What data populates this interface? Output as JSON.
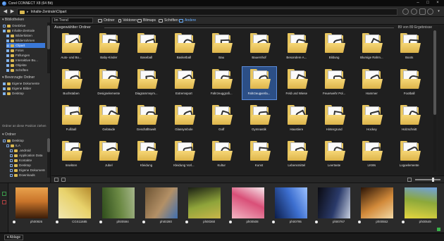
{
  "window": {
    "title": "Corel CONNECT X8 (64 Bit)"
  },
  "address_bar": {
    "path": "Inhalte-Zentrale\\Clipart"
  },
  "left_panel": {
    "library_header": "Bibliotheken",
    "library_items": [
      {
        "label": "OneDrive",
        "checked": false,
        "selected": false,
        "depth": 0
      },
      {
        "label": "Inhalte-Zentrale",
        "checked": true,
        "selected": false,
        "depth": 0
      },
      {
        "label": "Bilderkisten",
        "checked": true,
        "selected": false,
        "depth": 1
      },
      {
        "label": "Bilderrahmen",
        "checked": true,
        "selected": false,
        "depth": 1
      },
      {
        "label": "Clipart",
        "checked": true,
        "selected": true,
        "depth": 1
      },
      {
        "label": "Fotos",
        "checked": true,
        "selected": false,
        "depth": 1
      },
      {
        "label": "Füllungen",
        "checked": true,
        "selected": false,
        "depth": 1
      },
      {
        "label": "Interaktive Bu...",
        "checked": true,
        "selected": false,
        "depth": 1
      },
      {
        "label": "Objekte",
        "checked": true,
        "selected": false,
        "depth": 1
      },
      {
        "label": "Schriften",
        "checked": true,
        "selected": false,
        "depth": 1
      }
    ],
    "favorites_header": "Bevorzugte Ordner",
    "favorite_items": [
      {
        "label": "Eigene Dokumente",
        "checked": true
      },
      {
        "label": "Eigene Bilder",
        "checked": true
      },
      {
        "label": "Desktop",
        "checked": true
      }
    ],
    "drag_hint": "Ordner an diese Position ziehen",
    "folders_header": "Ordner",
    "folder_items": [
      {
        "label": "Desktop",
        "depth": 0
      },
      {
        "label": "ILA",
        "depth": 1
      },
      {
        "label": ".android",
        "depth": 2
      },
      {
        "label": "Application Data",
        "depth": 2
      },
      {
        "label": "Kontakte",
        "depth": 2
      },
      {
        "label": "Desktop",
        "depth": 2
      },
      {
        "label": "Eigene Dokumente",
        "depth": 2
      },
      {
        "label": "Downloads",
        "depth": 2
      }
    ]
  },
  "toolbar": {
    "search_value": "Im Trend",
    "buttons": [
      {
        "label": "Ordner",
        "icon": "folder-icon",
        "active": false
      },
      {
        "label": "Vektoren",
        "icon": "vector-icon",
        "active": false
      },
      {
        "label": "Bitmaps",
        "icon": "bitmap-icon",
        "active": false
      },
      {
        "label": "Schriften",
        "icon": "font-icon",
        "active": false
      },
      {
        "label": "Andere",
        "icon": "other-icon",
        "active": true
      }
    ]
  },
  "content": {
    "header": "Ausgewählter Ordner",
    "count": "89 von 89 Ergebnisse",
    "folders": [
      "Auto- und Bo...",
      "Baby-Kinder",
      "Baseball",
      "Basketball",
      "Bau",
      "Bauernhof",
      "Besondere A...",
      "Bildung",
      "Blumige Rahm...",
      "Boots",
      "Buchstaben",
      "Designelemente",
      "Diagrammsym...",
      "Extremsport",
      "Fahrzeuggrafi...",
      "Fahrzeugverla...",
      "Feld und Wiese",
      "Feuerwehr Pol...",
      "Hammer",
      "Football",
      "Fußball",
      "Gebäude",
      "Geschäftswelt",
      "Glassymbole",
      "Golf",
      "Gymnastik",
      "Haustiere",
      "Hintergrund",
      "Hockey",
      "Holzschnitt",
      "Insekten",
      "Jubel",
      "Kleidung",
      "Kleidung Vorl...",
      "Kultur",
      "Kunst",
      "Lebensmittel",
      "Leertaste",
      "LKWs",
      "Logoelemente"
    ],
    "selected_index": 15
  },
  "tray": {
    "items": [
      {
        "caption": "ph00926",
        "palette": [
          "#3a1d0a",
          "#c9742a",
          "#e8a24d"
        ]
      },
      {
        "caption": "CGS11685",
        "palette": [
          "#f1e7b0",
          "#e8d26b",
          "#b58b2e"
        ]
      },
      {
        "caption": "ph00594",
        "palette": [
          "#2f4d1c",
          "#6c8a45",
          "#a5b58a"
        ]
      },
      {
        "caption": "ph00280",
        "palette": [
          "#6d5434",
          "#b39066",
          "#3f6fb0"
        ]
      },
      {
        "caption": "ph00360",
        "palette": [
          "#1a1f14",
          "#8fa43a",
          "#c9b64a"
        ]
      },
      {
        "caption": "ph00508",
        "palette": [
          "#f2b6c4",
          "#d94f78",
          "#f7e8ec"
        ]
      },
      {
        "caption": "ph00795",
        "palette": [
          "#0c1d4a",
          "#3d6fd0",
          "#9bc0ff"
        ]
      },
      {
        "caption": "ph00767",
        "palette": [
          "#0a0a10",
          "#2a3a6a",
          "#c8d0e0"
        ]
      },
      {
        "caption": "ph00552",
        "palette": [
          "#2a1406",
          "#d28a3a",
          "#f3d9a5"
        ]
      },
      {
        "caption": "ph00549",
        "palette": [
          "#e4d640",
          "#8ca83a",
          "#6fa0e0"
        ]
      }
    ]
  },
  "bottom": {
    "tray_tab": "Ablage"
  },
  "colors": {
    "accent": "#3a78d8",
    "folder": "#e8c65e",
    "background": "#1e1e1e"
  }
}
